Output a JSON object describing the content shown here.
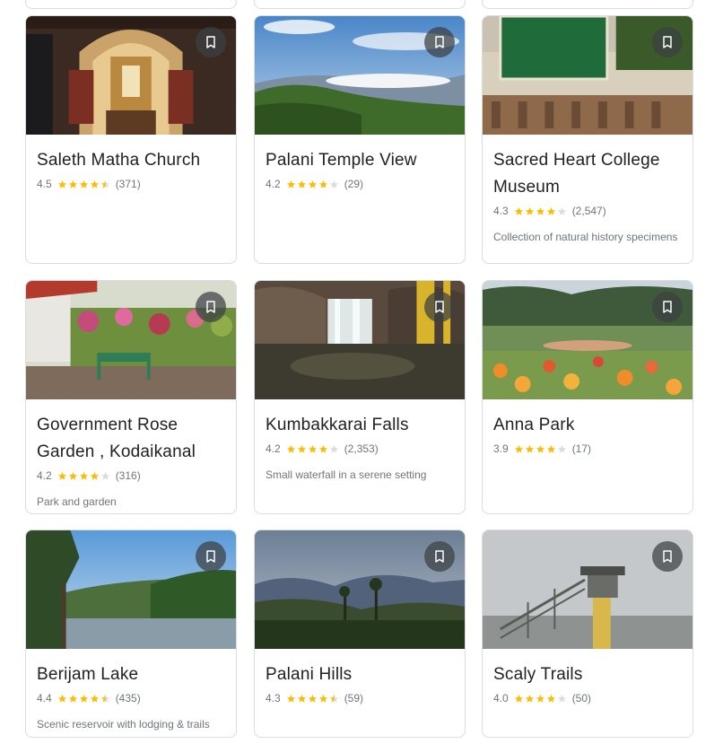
{
  "colors": {
    "star_on": "#fbbc04",
    "star_off": "#dadce0",
    "text": "#202124",
    "muted": "#70757a"
  },
  "icons": {
    "save": "bookmark-icon",
    "star": "star-icon"
  },
  "cards": [
    {
      "title": "Saleth Matha Church",
      "rating": "4.5",
      "stars": 4.5,
      "reviews": "(371)",
      "desc": ""
    },
    {
      "title": "Palani Temple View",
      "rating": "4.2",
      "stars": 4,
      "reviews": "(29)",
      "desc": ""
    },
    {
      "title": "Sacred Heart College Museum",
      "rating": "4.3",
      "stars": 4,
      "reviews": "(2,547)",
      "desc": "Collection of natural history specimens"
    },
    {
      "title": "Government Rose Garden , Kodaikanal",
      "rating": "4.2",
      "stars": 4,
      "reviews": "(316)",
      "desc": "Park and garden"
    },
    {
      "title": "Kumbakkarai Falls",
      "rating": "4.2",
      "stars": 4,
      "reviews": "(2,353)",
      "desc": "Small waterfall in a serene setting"
    },
    {
      "title": "Anna Park",
      "rating": "3.9",
      "stars": 4,
      "reviews": "(17)",
      "desc": ""
    },
    {
      "title": "Berijam Lake",
      "rating": "4.4",
      "stars": 4.5,
      "reviews": "(435)",
      "desc": "Scenic reservoir with lodging & trails"
    },
    {
      "title": "Palani Hills",
      "rating": "4.3",
      "stars": 4.5,
      "reviews": "(59)",
      "desc": ""
    },
    {
      "title": "Scaly Trails",
      "rating": "4.0",
      "stars": 4,
      "reviews": "(50)",
      "desc": ""
    }
  ]
}
